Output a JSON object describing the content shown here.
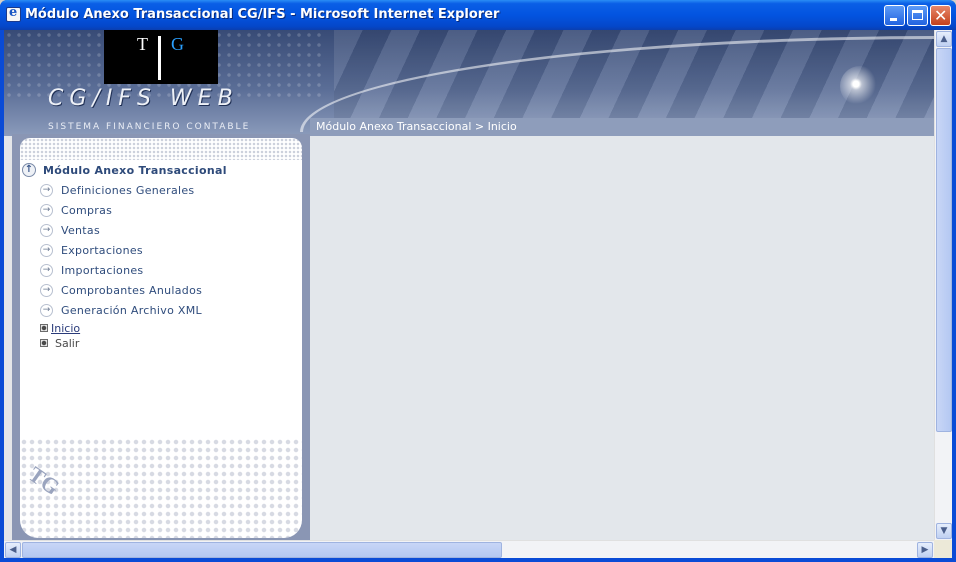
{
  "window": {
    "title": "Módulo Anexo Transaccional CG/IFS - Microsoft Internet Explorer"
  },
  "header": {
    "logo_left": "T",
    "logo_right": "G",
    "brand": "CG/IFS WEB",
    "brand_subtitle": "SISTEMA FINANCIERO CONTABLE",
    "breadcrumb": "Módulo Anexo Transaccional > Inicio"
  },
  "sidebar": {
    "section_title": "Módulo Anexo Transaccional",
    "items": [
      {
        "label": "Definiciones Generales"
      },
      {
        "label": "Compras"
      },
      {
        "label": "Ventas"
      },
      {
        "label": "Exportaciones"
      },
      {
        "label": "Importaciones"
      },
      {
        "label": "Comprobantes Anulados"
      },
      {
        "label": "Generación Archivo XML"
      }
    ],
    "links": [
      {
        "label": "Inicio"
      },
      {
        "label": "Salir"
      }
    ],
    "footer_logo": "TG"
  },
  "icons": {
    "section": "collapse-up-icon",
    "item": "arrow-right-circle-icon",
    "link": "bullet-square-icon"
  },
  "colors": {
    "titlebar": "#0354e0",
    "menu_text": "#2f4c7c",
    "content_bg": "#e3e7eb"
  }
}
